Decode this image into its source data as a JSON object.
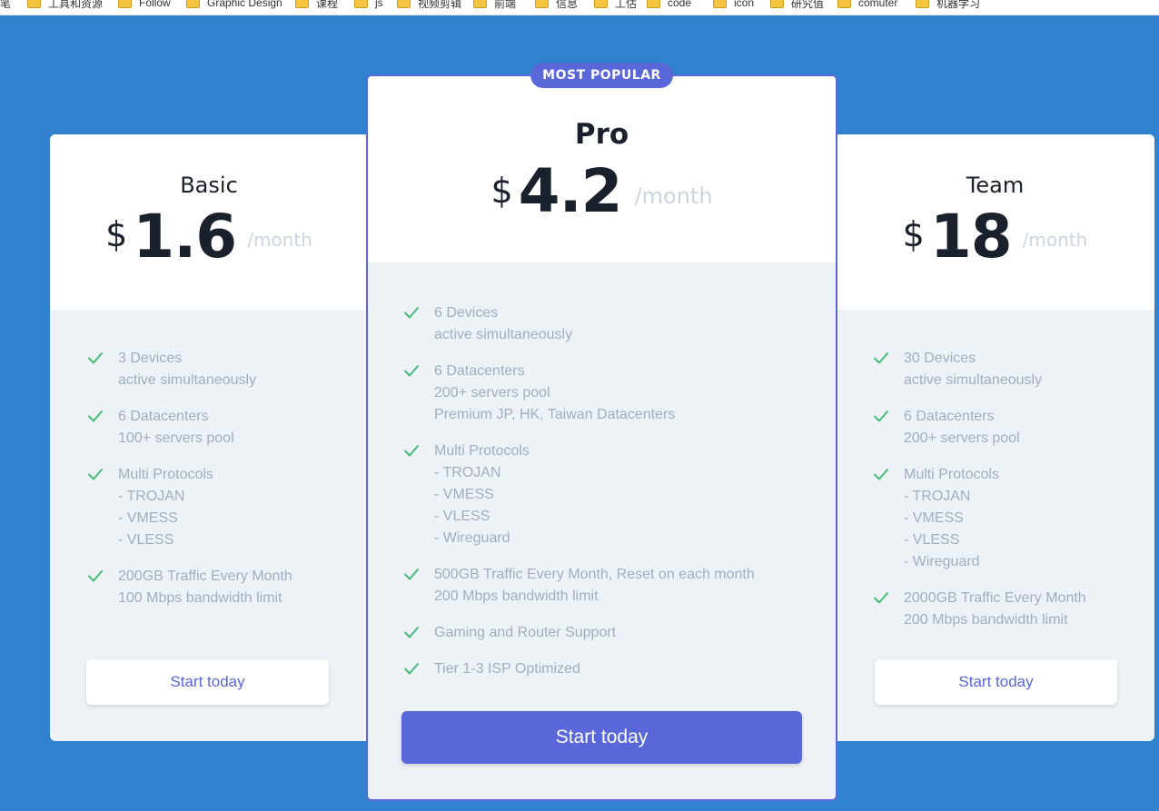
{
  "bookmarks": [
    {
      "label": "笔",
      "icon": "none"
    },
    {
      "label": "工具和资源",
      "icon": "folder-icon"
    },
    {
      "label": "Follow",
      "icon": "folder-icon"
    },
    {
      "label": "Graphic Design",
      "icon": "folder-icon"
    },
    {
      "label": "课程",
      "icon": "folder-icon"
    },
    {
      "label": "js",
      "icon": "folder-icon"
    },
    {
      "label": "视频剪辑",
      "icon": "folder-icon"
    },
    {
      "label": "前端",
      "icon": "folder-icon"
    },
    {
      "label": "信息",
      "icon": "folder-icon"
    },
    {
      "label": "工估",
      "icon": "folder-icon"
    },
    {
      "label": "code",
      "icon": "folder-icon"
    },
    {
      "label": "icon",
      "icon": "folder-icon"
    },
    {
      "label": "研究值",
      "icon": "folder-icon"
    },
    {
      "label": "comuter",
      "icon": "folder-icon"
    },
    {
      "label": "机器学习",
      "icon": "folder-icon"
    }
  ],
  "badge": "MOST POPULAR",
  "colors": {
    "background": "#3182ce",
    "accent": "#5a67d8",
    "check": "#48bb78",
    "feature_text": "#a0aec0",
    "muted": "#cbd5e0"
  },
  "plans": {
    "basic": {
      "name": "Basic",
      "currency": "$",
      "price": "1.6",
      "period": "/month",
      "features": [
        [
          "3 Devices",
          "active simultaneously"
        ],
        [
          "6 Datacenters",
          "100+ servers pool"
        ],
        [
          "Multi Protocols",
          "- TROJAN",
          "- VMESS",
          "- VLESS"
        ],
        [
          "200GB Traffic Every Month",
          "100 Mbps bandwidth limit"
        ]
      ],
      "cta": "Start today"
    },
    "pro": {
      "name": "Pro",
      "currency": "$",
      "price": "4.2",
      "period": "/month",
      "features": [
        [
          "6 Devices",
          "active simultaneously"
        ],
        [
          "6 Datacenters",
          "200+ servers pool",
          "Premium JP, HK, Taiwan Datacenters"
        ],
        [
          "Multi Protocols",
          "- TROJAN",
          "- VMESS",
          "- VLESS",
          "- Wireguard"
        ],
        [
          "500GB Traffic Every Month, Reset on each month",
          "200 Mbps bandwidth limit"
        ],
        [
          "Gaming and Router Support"
        ],
        [
          "Tier 1-3 ISP Optimized"
        ]
      ],
      "cta": "Start today"
    },
    "team": {
      "name": "Team",
      "currency": "$",
      "price": "18",
      "period": "/month",
      "features": [
        [
          "30 Devices",
          "active simultaneously"
        ],
        [
          "6 Datacenters",
          "200+ servers pool"
        ],
        [
          "Multi Protocols",
          "- TROJAN",
          "- VMESS",
          "- VLESS",
          "- Wireguard"
        ],
        [
          "2000GB Traffic Every Month",
          "200 Mbps bandwidth limit"
        ]
      ],
      "cta": "Start today"
    }
  }
}
